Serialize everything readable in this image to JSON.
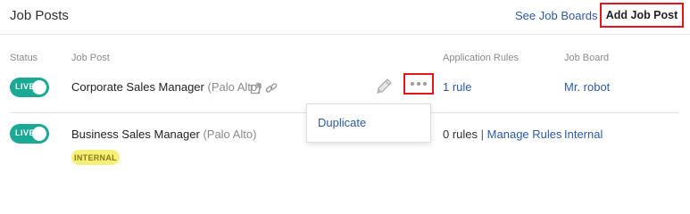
{
  "header": {
    "title": "Job Posts",
    "see_job_boards": "See Job Boards",
    "add_job_post": "Add Job Post"
  },
  "columns": {
    "status": "Status",
    "job_post": "Job Post",
    "application_rules": "Application Rules",
    "job_board": "Job Board"
  },
  "rows": [
    {
      "status": "LIVE",
      "job_title": "Corporate Sales Manager",
      "location": "(Palo Alto)",
      "rules": "1 rule",
      "board": "Mr. robot"
    },
    {
      "status": "LIVE",
      "job_title": "Business Sales Manager",
      "location": "(Palo Alto)",
      "rules": "0 rules",
      "rules_sep": "|",
      "manage_rules": "Manage Rules",
      "board": "Internal",
      "badge": "INTERNAL"
    }
  ],
  "menu": {
    "items": [
      "Duplicate"
    ]
  },
  "icons": {
    "external": "external-link-icon",
    "link": "link-icon",
    "edit": "pencil-icon",
    "more": "more-dots-icon"
  },
  "colors": {
    "accent_link": "#2c5aa8",
    "toggle_on": "#1aa995",
    "highlight_border": "#e8141b",
    "badge_bg": "#f6f077"
  }
}
